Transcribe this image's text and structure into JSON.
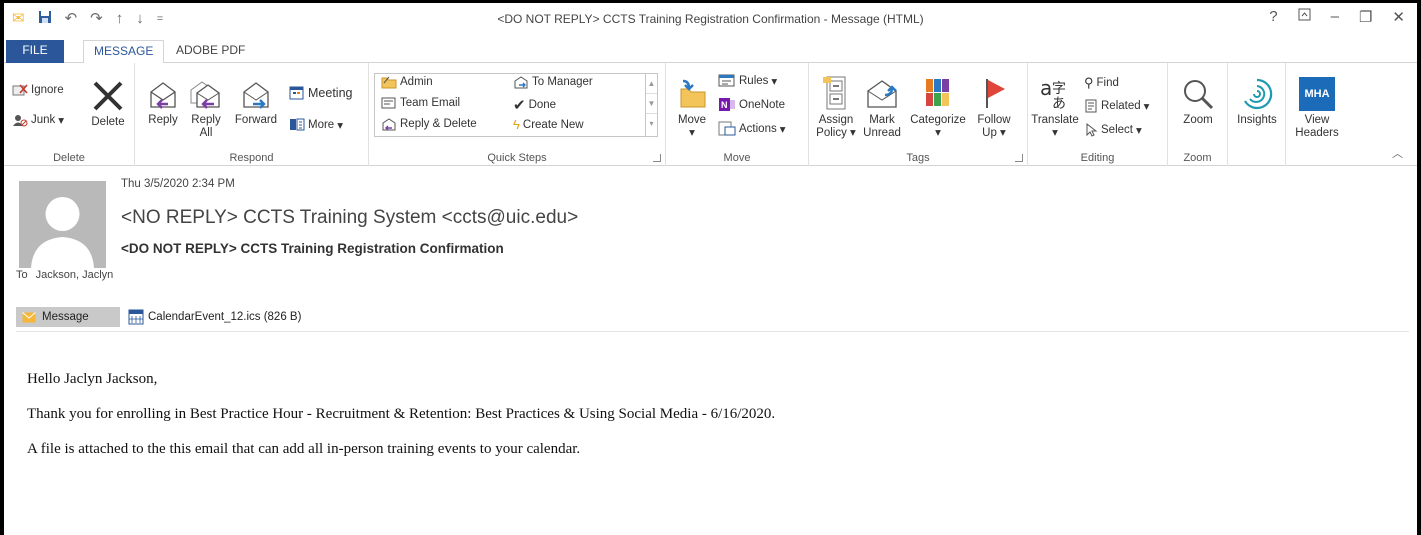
{
  "window": {
    "title": "<DO NOT REPLY> CCTS Training Registration Confirmation - Message (HTML)",
    "controls": {
      "help": "?",
      "restore_ribbon": "⊼",
      "minimize": "–",
      "restore": "❐",
      "close": "✕"
    }
  },
  "qat": {
    "undo": "↶",
    "redo": "↷",
    "up": "↑",
    "down": "↓",
    "customize": "="
  },
  "tabs": {
    "file": "FILE",
    "message": "MESSAGE",
    "adobe": "ADOBE PDF"
  },
  "ribbon": {
    "delete_group": {
      "label": "Delete",
      "ignore": "Ignore",
      "junk": "Junk",
      "delete": "Delete"
    },
    "respond_group": {
      "label": "Respond",
      "reply": "Reply",
      "reply_all_1": "Reply",
      "reply_all_2": "All",
      "forward": "Forward",
      "meeting": "Meeting",
      "more": "More"
    },
    "quick_steps": {
      "label": "Quick Steps",
      "admin": "Admin",
      "team_email": "Team Email",
      "reply_delete": "Reply & Delete",
      "to_manager": "To Manager",
      "done": "Done",
      "create_new": "Create New"
    },
    "move_group": {
      "label": "Move",
      "move": "Move",
      "rules": "Rules",
      "onenote": "OneNote",
      "actions": "Actions"
    },
    "tags_group": {
      "label": "Tags",
      "assign_1": "Assign",
      "assign_2": "Policy",
      "mark_1": "Mark",
      "mark_2": "Unread",
      "categorize": "Categorize",
      "follow_1": "Follow",
      "follow_2": "Up"
    },
    "editing_group": {
      "label": "Editing",
      "translate": "Translate",
      "find": "Find",
      "related": "Related",
      "select": "Select"
    },
    "zoom_group": {
      "label": "Zoom",
      "zoom": "Zoom"
    },
    "insights": "Insights",
    "mha": {
      "badge": "MHA",
      "view_1": "View",
      "view_2": "Headers"
    }
  },
  "message": {
    "date": "Thu 3/5/2020 2:34 PM",
    "sender": "<NO REPLY> CCTS Training System <ccts@uic.edu>",
    "subject": "<DO NOT REPLY> CCTS Training Registration Confirmation",
    "to_label": "To",
    "to_value": "Jackson, Jaclyn",
    "attachments": {
      "message_tab": "Message",
      "file": "CalendarEvent_12.ics (826 B)"
    },
    "body": [
      "Hello Jaclyn Jackson,",
      "Thank you for enrolling in Best Practice Hour - Recruitment & Retention: Best Practices & Using Social Media - 6/16/2020.",
      "A file is attached to the this email that can add all in-person training events to your calendar."
    ]
  },
  "colors": {
    "accent": "#2b579a",
    "file_tab": "#2b579a",
    "avatar": "#b9b9b9"
  }
}
